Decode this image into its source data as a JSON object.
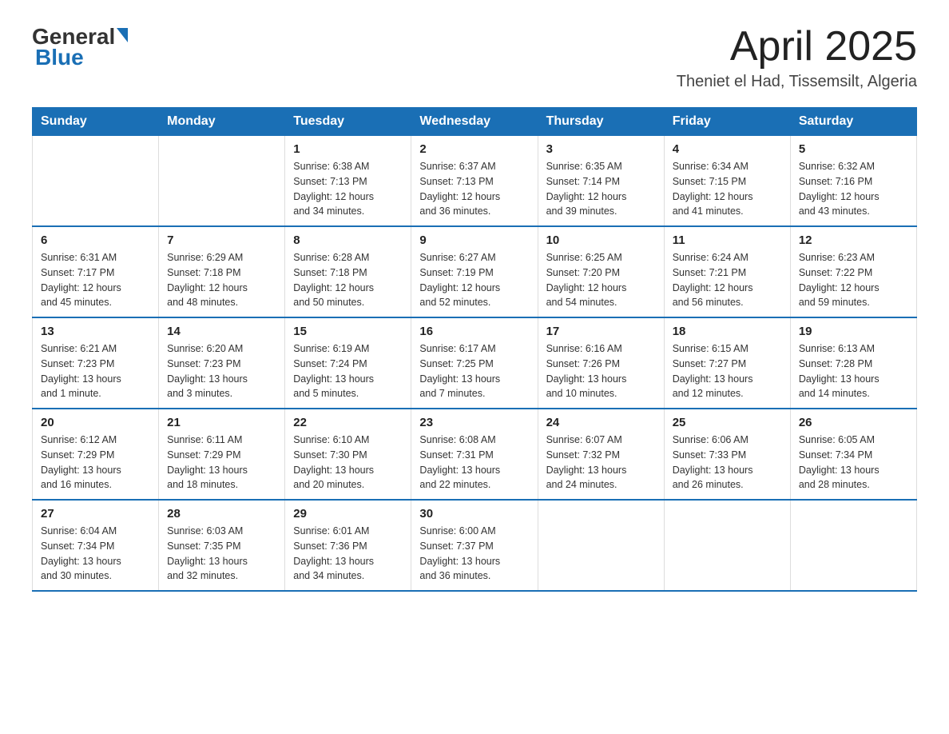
{
  "header": {
    "logo": {
      "general": "General",
      "blue": "Blue"
    },
    "title": "April 2025",
    "subtitle": "Theniet el Had, Tissemsilt, Algeria"
  },
  "calendar": {
    "weekdays": [
      "Sunday",
      "Monday",
      "Tuesday",
      "Wednesday",
      "Thursday",
      "Friday",
      "Saturday"
    ],
    "weeks": [
      [
        {
          "day": "",
          "info": ""
        },
        {
          "day": "",
          "info": ""
        },
        {
          "day": "1",
          "info": "Sunrise: 6:38 AM\nSunset: 7:13 PM\nDaylight: 12 hours\nand 34 minutes."
        },
        {
          "day": "2",
          "info": "Sunrise: 6:37 AM\nSunset: 7:13 PM\nDaylight: 12 hours\nand 36 minutes."
        },
        {
          "day": "3",
          "info": "Sunrise: 6:35 AM\nSunset: 7:14 PM\nDaylight: 12 hours\nand 39 minutes."
        },
        {
          "day": "4",
          "info": "Sunrise: 6:34 AM\nSunset: 7:15 PM\nDaylight: 12 hours\nand 41 minutes."
        },
        {
          "day": "5",
          "info": "Sunrise: 6:32 AM\nSunset: 7:16 PM\nDaylight: 12 hours\nand 43 minutes."
        }
      ],
      [
        {
          "day": "6",
          "info": "Sunrise: 6:31 AM\nSunset: 7:17 PM\nDaylight: 12 hours\nand 45 minutes."
        },
        {
          "day": "7",
          "info": "Sunrise: 6:29 AM\nSunset: 7:18 PM\nDaylight: 12 hours\nand 48 minutes."
        },
        {
          "day": "8",
          "info": "Sunrise: 6:28 AM\nSunset: 7:18 PM\nDaylight: 12 hours\nand 50 minutes."
        },
        {
          "day": "9",
          "info": "Sunrise: 6:27 AM\nSunset: 7:19 PM\nDaylight: 12 hours\nand 52 minutes."
        },
        {
          "day": "10",
          "info": "Sunrise: 6:25 AM\nSunset: 7:20 PM\nDaylight: 12 hours\nand 54 minutes."
        },
        {
          "day": "11",
          "info": "Sunrise: 6:24 AM\nSunset: 7:21 PM\nDaylight: 12 hours\nand 56 minutes."
        },
        {
          "day": "12",
          "info": "Sunrise: 6:23 AM\nSunset: 7:22 PM\nDaylight: 12 hours\nand 59 minutes."
        }
      ],
      [
        {
          "day": "13",
          "info": "Sunrise: 6:21 AM\nSunset: 7:23 PM\nDaylight: 13 hours\nand 1 minute."
        },
        {
          "day": "14",
          "info": "Sunrise: 6:20 AM\nSunset: 7:23 PM\nDaylight: 13 hours\nand 3 minutes."
        },
        {
          "day": "15",
          "info": "Sunrise: 6:19 AM\nSunset: 7:24 PM\nDaylight: 13 hours\nand 5 minutes."
        },
        {
          "day": "16",
          "info": "Sunrise: 6:17 AM\nSunset: 7:25 PM\nDaylight: 13 hours\nand 7 minutes."
        },
        {
          "day": "17",
          "info": "Sunrise: 6:16 AM\nSunset: 7:26 PM\nDaylight: 13 hours\nand 10 minutes."
        },
        {
          "day": "18",
          "info": "Sunrise: 6:15 AM\nSunset: 7:27 PM\nDaylight: 13 hours\nand 12 minutes."
        },
        {
          "day": "19",
          "info": "Sunrise: 6:13 AM\nSunset: 7:28 PM\nDaylight: 13 hours\nand 14 minutes."
        }
      ],
      [
        {
          "day": "20",
          "info": "Sunrise: 6:12 AM\nSunset: 7:29 PM\nDaylight: 13 hours\nand 16 minutes."
        },
        {
          "day": "21",
          "info": "Sunrise: 6:11 AM\nSunset: 7:29 PM\nDaylight: 13 hours\nand 18 minutes."
        },
        {
          "day": "22",
          "info": "Sunrise: 6:10 AM\nSunset: 7:30 PM\nDaylight: 13 hours\nand 20 minutes."
        },
        {
          "day": "23",
          "info": "Sunrise: 6:08 AM\nSunset: 7:31 PM\nDaylight: 13 hours\nand 22 minutes."
        },
        {
          "day": "24",
          "info": "Sunrise: 6:07 AM\nSunset: 7:32 PM\nDaylight: 13 hours\nand 24 minutes."
        },
        {
          "day": "25",
          "info": "Sunrise: 6:06 AM\nSunset: 7:33 PM\nDaylight: 13 hours\nand 26 minutes."
        },
        {
          "day": "26",
          "info": "Sunrise: 6:05 AM\nSunset: 7:34 PM\nDaylight: 13 hours\nand 28 minutes."
        }
      ],
      [
        {
          "day": "27",
          "info": "Sunrise: 6:04 AM\nSunset: 7:34 PM\nDaylight: 13 hours\nand 30 minutes."
        },
        {
          "day": "28",
          "info": "Sunrise: 6:03 AM\nSunset: 7:35 PM\nDaylight: 13 hours\nand 32 minutes."
        },
        {
          "day": "29",
          "info": "Sunrise: 6:01 AM\nSunset: 7:36 PM\nDaylight: 13 hours\nand 34 minutes."
        },
        {
          "day": "30",
          "info": "Sunrise: 6:00 AM\nSunset: 7:37 PM\nDaylight: 13 hours\nand 36 minutes."
        },
        {
          "day": "",
          "info": ""
        },
        {
          "day": "",
          "info": ""
        },
        {
          "day": "",
          "info": ""
        }
      ]
    ]
  }
}
